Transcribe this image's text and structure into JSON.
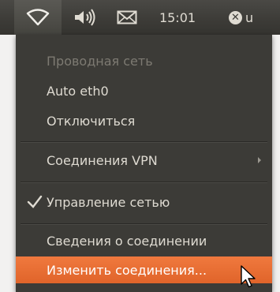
{
  "panel": {
    "clock": "15:01",
    "user_partial": "u",
    "icons": [
      "network-wireless-icon",
      "speaker-volume-icon",
      "mail-envelope-icon",
      "user-status-icon"
    ]
  },
  "menu": {
    "items": [
      {
        "label": "Проводная сеть",
        "state": "disabled"
      },
      {
        "label": "Auto eth0",
        "state": "normal"
      },
      {
        "label": "Отключиться",
        "state": "normal"
      },
      {
        "label": "Соединения VPN",
        "state": "submenu"
      },
      {
        "label": "Управление сетью",
        "state": "checked"
      },
      {
        "label": "Сведения о соединении",
        "state": "normal"
      },
      {
        "label": "Изменить соединения...",
        "state": "highlighted"
      }
    ]
  },
  "colors": {
    "panel_bg": "#3c3b37",
    "menu_bg": "#3c3b37",
    "menu_text": "#dfdbd2",
    "disabled_text": "#7d7a72",
    "highlight": "#e9702f"
  }
}
